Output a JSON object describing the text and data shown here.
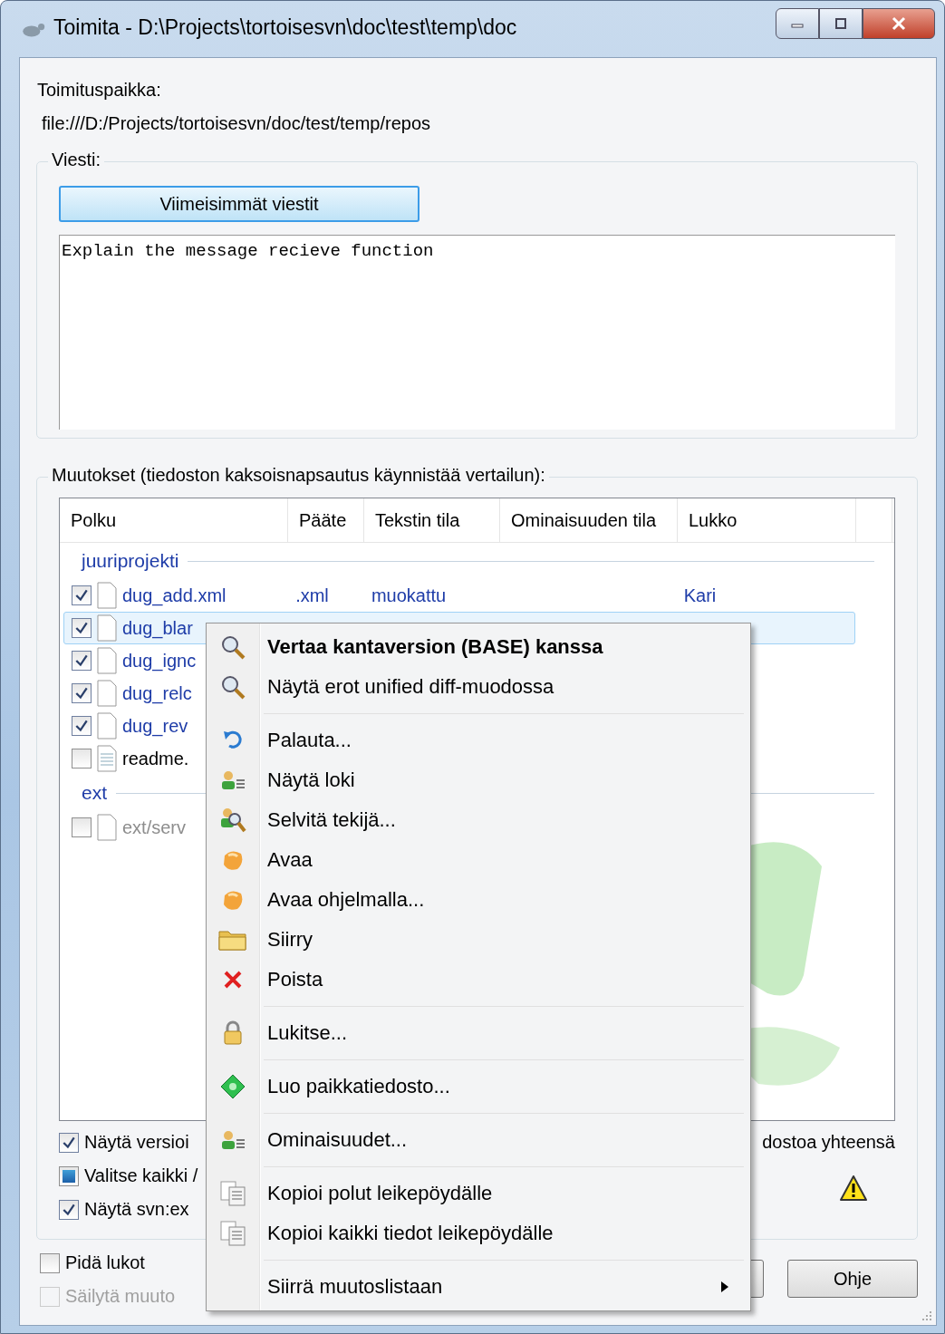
{
  "window": {
    "title": "Toimita - D:\\Projects\\tortoisesvn\\doc\\test\\temp\\doc"
  },
  "location": {
    "label": "Toimituspaikka:",
    "value": "file:///D:/Projects/tortoisesvn/doc/test/temp/repos"
  },
  "message": {
    "label": "Viesti:",
    "recent_button": "Viimeisimmät viestit",
    "text": "Explain the message recieve function"
  },
  "changes": {
    "label": "Muutokset (tiedoston kaksoisnapsautus käynnistää vertailun):",
    "columns": [
      "Polku",
      "Pääte",
      "Tekstin tila",
      "Ominaisuuden tila",
      "Lukko"
    ],
    "groups": [
      {
        "name": "juuriprojekti",
        "rows": [
          {
            "checked": true,
            "selected": false,
            "disabled": false,
            "kind": "file",
            "path": "dug_add.xml",
            "ext": ".xml",
            "status": "muokattu",
            "lock": "Kari"
          },
          {
            "checked": true,
            "selected": true,
            "disabled": false,
            "kind": "file",
            "path": "dug_blar"
          },
          {
            "checked": true,
            "selected": false,
            "disabled": false,
            "kind": "file",
            "path": "dug_ignc"
          },
          {
            "checked": true,
            "selected": false,
            "disabled": false,
            "kind": "file",
            "path": "dug_relc"
          },
          {
            "checked": true,
            "selected": false,
            "disabled": false,
            "kind": "file",
            "path": "dug_rev"
          },
          {
            "checked": false,
            "selected": false,
            "disabled": false,
            "kind": "text",
            "path": "readme."
          }
        ]
      },
      {
        "name": "ext",
        "rows": [
          {
            "checked": false,
            "selected": false,
            "disabled": true,
            "kind": "file",
            "path": "ext/serv"
          }
        ]
      }
    ],
    "options": [
      {
        "label": "Näytä versioi",
        "checked": true
      },
      {
        "label": "Valitse kaikki /",
        "checked": false,
        "mixed": true
      },
      {
        "label": "Näytä svn:ex",
        "checked": true
      }
    ],
    "summary": "dostoa yhteensä"
  },
  "bottom_options": [
    {
      "label": "Pidä lukot",
      "checked": false,
      "disabled": false
    },
    {
      "label": "Säilytä muuto",
      "checked": false,
      "disabled": true
    }
  ],
  "buttons": [
    {
      "label": "Ohje"
    }
  ],
  "context_menu": [
    [
      {
        "label": "Vertaa kantaversion (BASE) kanssa",
        "default": true,
        "kind": "magnifier"
      },
      {
        "label": "Näytä erot unified diff-muodossa",
        "default": false,
        "kind": "magnifier"
      }
    ],
    [
      {
        "label": "Palauta...",
        "default": false,
        "kind": "undo"
      },
      {
        "label": "Näytä loki",
        "default": false,
        "kind": "person"
      },
      {
        "label": "Selvitä tekijä...",
        "default": false,
        "kind": "person-search"
      },
      {
        "label": "Avaa",
        "default": false,
        "kind": "orange"
      },
      {
        "label": "Avaa ohjelmalla...",
        "default": false,
        "kind": "orange"
      },
      {
        "label": "Siirry",
        "default": false,
        "kind": "folder"
      },
      {
        "label": "Poista",
        "default": false,
        "kind": "cross"
      }
    ],
    [
      {
        "label": "Lukitse...",
        "default": false,
        "kind": "lock"
      }
    ],
    [
      {
        "label": "Luo paikkatiedosto...",
        "default": false,
        "kind": "puzzle"
      }
    ],
    [
      {
        "label": "Ominaisuudet...",
        "default": false,
        "kind": "person"
      }
    ],
    [
      {
        "label": "Kopioi polut leikepöydälle",
        "default": false,
        "kind": "copy"
      },
      {
        "label": "Kopioi kaikki tiedot leikepöydälle",
        "default": false,
        "kind": "copy"
      }
    ],
    [
      {
        "label": "Siirrä muutoslistaan",
        "default": false,
        "kind": "submenu"
      }
    ]
  ]
}
